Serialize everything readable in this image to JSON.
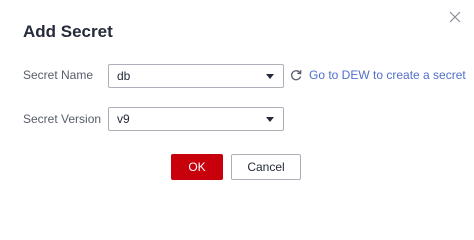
{
  "dialog": {
    "title": "Add Secret"
  },
  "form": {
    "secret_name": {
      "label": "Secret Name",
      "value": "db"
    },
    "secret_version": {
      "label": "Secret Version",
      "value": "v9"
    },
    "dew_link": "Go to DEW to create a secret"
  },
  "footer": {
    "ok_label": "OK",
    "cancel_label": "Cancel"
  },
  "icons": {
    "close": "close-icon",
    "refresh": "refresh-icon",
    "dropdown": "caret-down-icon"
  },
  "colors": {
    "primary": "#c7000b",
    "link": "#526ecc",
    "text": "#252b3a",
    "label": "#575d6c",
    "border": "#adb0b8"
  }
}
